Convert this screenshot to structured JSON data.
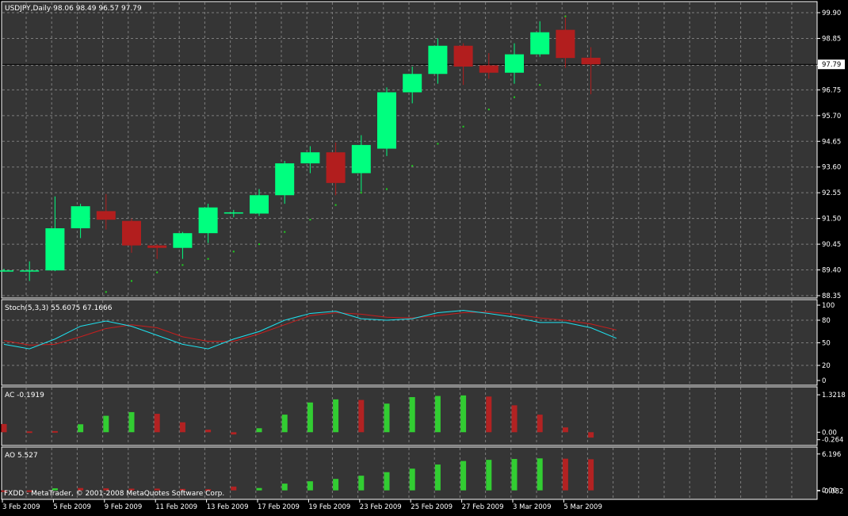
{
  "colors": {
    "background": "#000000",
    "panel": "#353535",
    "grid": "#7d7d7d",
    "frame": "#ffffff",
    "bull_candle": "#00ff7f",
    "bear_candle": "#b21e1e",
    "parabolic_sar": "#1ed11e",
    "stoch_main": "#1ee2f0",
    "stoch_signal": "#c81e1e",
    "hist_up": "#32cd32",
    "hist_down": "#b22222",
    "price_line": "#000000"
  },
  "footer_text": "FXDD - MetaTrader, © 2001-2008 MetaQuotes Software Corp.",
  "chart_data": [
    {
      "type": "candlestick",
      "title": "USDJPY,Daily  98.06 98.49 96.57 97.79",
      "symbol": "USDJPY",
      "timeframe": "Daily",
      "current_price_label": "97.79",
      "current_price": 97.79,
      "ylim": [
        88.35,
        99.9
      ],
      "yticks": [
        "99.90",
        "98.85",
        "97.75",
        "96.75",
        "95.70",
        "94.65",
        "93.60",
        "92.55",
        "91.50",
        "90.45",
        "89.40",
        "88.35"
      ],
      "ytick_values": [
        99.9,
        98.85,
        97.75,
        96.75,
        95.7,
        94.65,
        93.6,
        92.55,
        91.5,
        90.45,
        89.4,
        88.35
      ],
      "x_labels": [
        "3 Feb 2009",
        "5 Feb 2009",
        "9 Feb 2009",
        "11 Feb 2009",
        "13 Feb 2009",
        "17 Feb 2009",
        "19 Feb 2009",
        "23 Feb 2009",
        "25 Feb 2009",
        "27 Feb 2009",
        "3 Mar 2009",
        "5 Mar 2009"
      ],
      "x_label_bar_index": [
        0,
        2,
        4,
        6,
        8,
        10,
        12,
        14,
        16,
        18,
        20,
        22
      ],
      "candles": [
        {
          "o": 89.38,
          "h": 89.45,
          "l": 89.33,
          "c": 89.38
        },
        {
          "o": 89.38,
          "h": 89.75,
          "l": 88.95,
          "c": 89.38
        },
        {
          "o": 89.38,
          "h": 92.4,
          "l": 89.35,
          "c": 91.1
        },
        {
          "o": 91.1,
          "h": 92.1,
          "l": 90.7,
          "c": 92.0
        },
        {
          "o": 91.8,
          "h": 92.5,
          "l": 91.05,
          "c": 91.45
        },
        {
          "o": 91.4,
          "h": 91.5,
          "l": 90.1,
          "c": 90.4
        },
        {
          "o": 90.4,
          "h": 90.45,
          "l": 89.85,
          "c": 90.3
        },
        {
          "o": 90.3,
          "h": 90.95,
          "l": 89.85,
          "c": 90.9
        },
        {
          "o": 90.9,
          "h": 92.1,
          "l": 90.5,
          "c": 91.95
        },
        {
          "o": 91.7,
          "h": 91.85,
          "l": 91.55,
          "c": 91.75
        },
        {
          "o": 91.7,
          "h": 92.7,
          "l": 91.6,
          "c": 92.45
        },
        {
          "o": 92.45,
          "h": 93.85,
          "l": 92.1,
          "c": 93.75
        },
        {
          "o": 93.75,
          "h": 94.45,
          "l": 93.35,
          "c": 94.2
        },
        {
          "o": 94.2,
          "h": 94.6,
          "l": 92.45,
          "c": 92.95
        },
        {
          "o": 93.35,
          "h": 94.9,
          "l": 92.6,
          "c": 94.5
        },
        {
          "o": 94.35,
          "h": 96.85,
          "l": 94.05,
          "c": 96.65
        },
        {
          "o": 96.65,
          "h": 97.7,
          "l": 96.2,
          "c": 97.4
        },
        {
          "o": 97.4,
          "h": 98.85,
          "l": 97.0,
          "c": 98.55
        },
        {
          "o": 98.55,
          "h": 98.65,
          "l": 96.95,
          "c": 97.7
        },
        {
          "o": 97.75,
          "h": 98.25,
          "l": 97.2,
          "c": 97.45
        },
        {
          "o": 97.45,
          "h": 98.65,
          "l": 97.0,
          "c": 98.2
        },
        {
          "o": 98.2,
          "h": 99.55,
          "l": 98.1,
          "c": 99.1
        },
        {
          "o": 99.2,
          "h": 99.8,
          "l": 97.65,
          "c": 98.05
        },
        {
          "o": 98.06,
          "h": 98.49,
          "l": 96.57,
          "c": 97.79
        }
      ],
      "parabolic_sar": [
        null,
        null,
        null,
        null,
        88.5,
        88.95,
        89.3,
        89.6,
        89.85,
        90.15,
        90.45,
        90.95,
        91.45,
        92.05,
        92.55,
        92.7,
        93.65,
        94.55,
        95.25,
        95.95,
        96.45,
        96.95,
        99.75,
        null
      ],
      "sar_last_above": 99.75
    },
    {
      "type": "line",
      "title": "Stoch(5,3,3) 55.6075 67.1666",
      "ylim": [
        0,
        100
      ],
      "yticks": [
        "100",
        "80",
        "50",
        "20",
        "0"
      ],
      "ytick_values": [
        100,
        80,
        50,
        20,
        0
      ],
      "dashed_levels": [
        80,
        50,
        20
      ],
      "series": [
        {
          "name": "main",
          "values": [
            48,
            42,
            55,
            72,
            79,
            72,
            60,
            48,
            42,
            55,
            65,
            80,
            89,
            92,
            82,
            80,
            82,
            90,
            93,
            89,
            84,
            77,
            77,
            70,
            56
          ]
        },
        {
          "name": "signal",
          "values": [
            53,
            47,
            48,
            58,
            69,
            74,
            70,
            58,
            52,
            52,
            62,
            74,
            86,
            90,
            88,
            84,
            83,
            86,
            90,
            91,
            88,
            83,
            80,
            75,
            67
          ]
        }
      ]
    },
    {
      "type": "bar",
      "title": "AC -0.1919",
      "yticks": [
        "1.3218",
        "0.00",
        "-0.264"
      ],
      "ytick_values": [
        1.3218,
        0.0,
        -0.264
      ],
      "ylim": [
        -0.3,
        1.38
      ],
      "values": [
        0.29,
        0.03,
        0.04,
        0.28,
        0.58,
        0.71,
        0.65,
        0.35,
        0.09,
        -0.08,
        0.14,
        0.62,
        1.05,
        1.16,
        1.14,
        1.01,
        1.24,
        1.28,
        1.3,
        1.26,
        0.95,
        0.62,
        0.17,
        -0.19
      ],
      "colors": [
        "down",
        "down",
        "down",
        "up",
        "up",
        "up",
        "down",
        "down",
        "down",
        "down",
        "up",
        "up",
        "up",
        "up",
        "down",
        "up",
        "up",
        "up",
        "up",
        "down",
        "down",
        "down",
        "down",
        "down"
      ]
    },
    {
      "type": "bar",
      "title": "AO 5.527",
      "yticks": [
        "6.196",
        "0.00",
        "-0.082"
      ],
      "ytick_values": [
        6.196,
        0.0,
        -0.082
      ],
      "ylim": [
        -0.45,
        6.3
      ],
      "values": [
        0,
        0,
        0.35,
        0.4,
        0.35,
        0.3,
        0.3,
        0.25,
        0.2,
        0.65,
        0.4,
        1.15,
        1.55,
        1.95,
        2.5,
        3.1,
        3.7,
        4.4,
        5.0,
        5.2,
        5.35,
        5.45,
        5.4,
        5.3
      ],
      "colors": [
        "down",
        "down",
        "up",
        "down",
        "down",
        "down",
        "down",
        "down",
        "down",
        "down",
        "up",
        "up",
        "up",
        "up",
        "up",
        "up",
        "up",
        "up",
        "up",
        "up",
        "up",
        "up",
        "down",
        "down"
      ]
    }
  ]
}
